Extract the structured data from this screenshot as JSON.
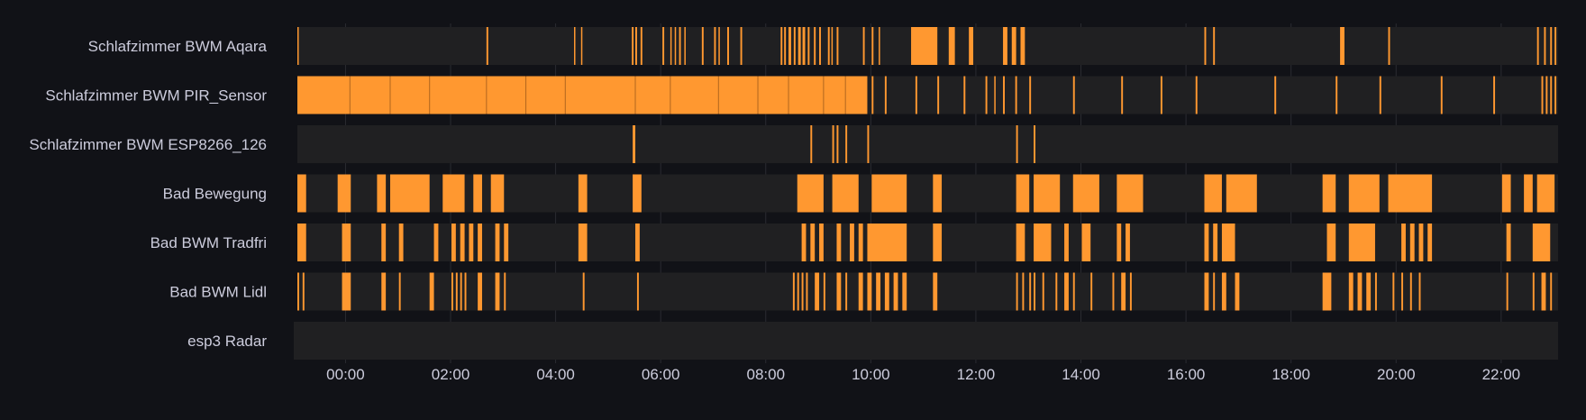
{
  "chart_data": {
    "type": "state-timeline",
    "x_range": [
      "23:05",
      "23:05"
    ],
    "x_tick_labels": [
      "00:00",
      "02:00",
      "04:00",
      "06:00",
      "08:00",
      "10:00",
      "12:00",
      "14:00",
      "16:00",
      "18:00",
      "20:00",
      "22:00"
    ],
    "active_color": "#ff9830",
    "inactive_color": "#202022",
    "grid": true,
    "rows": [
      {
        "label": "Schlafzimmer BWM Aqara",
        "active_intervals": [
          [
            "23:05",
            "23:06"
          ],
          [
            "02:41",
            "02:43"
          ],
          [
            "04:21",
            "04:22"
          ],
          [
            "04:29",
            "04:30"
          ],
          [
            "05:27",
            "05:29"
          ],
          [
            "05:31",
            "05:33"
          ],
          [
            "05:37",
            "05:39"
          ],
          [
            "06:02",
            "06:04"
          ],
          [
            "06:11",
            "06:12"
          ],
          [
            "06:16",
            "06:17"
          ],
          [
            "06:21",
            "06:23"
          ],
          [
            "06:27",
            "06:28"
          ],
          [
            "06:47",
            "06:49"
          ],
          [
            "07:01",
            "07:03"
          ],
          [
            "07:06",
            "07:07"
          ],
          [
            "07:16",
            "07:18"
          ],
          [
            "07:31",
            "07:33"
          ],
          [
            "08:17",
            "08:19"
          ],
          [
            "08:21",
            "08:23"
          ],
          [
            "08:26",
            "08:29"
          ],
          [
            "08:32",
            "08:34"
          ],
          [
            "08:37",
            "08:40"
          ],
          [
            "08:42",
            "08:45"
          ],
          [
            "08:48",
            "08:50"
          ],
          [
            "08:55",
            "08:57"
          ],
          [
            "09:01",
            "09:03"
          ],
          [
            "09:11",
            "09:13"
          ],
          [
            "09:15",
            "09:16"
          ],
          [
            "09:21",
            "09:23"
          ],
          [
            "09:51",
            "09:53"
          ],
          [
            "10:01",
            "10:03"
          ],
          [
            "10:09",
            "10:10"
          ],
          [
            "10:46",
            "11:16"
          ],
          [
            "11:29",
            "11:36"
          ],
          [
            "11:52",
            "11:57"
          ],
          [
            "12:31",
            "12:36"
          ],
          [
            "12:41",
            "12:46"
          ],
          [
            "12:51",
            "12:56"
          ],
          [
            "16:21",
            "16:23"
          ],
          [
            "16:31",
            "16:33"
          ],
          [
            "18:56",
            "19:01"
          ],
          [
            "19:51",
            "19:53"
          ],
          [
            "22:41",
            "22:43"
          ],
          [
            "22:49",
            "22:51"
          ],
          [
            "22:56",
            "22:58"
          ],
          [
            "23:01",
            "23:03"
          ]
        ]
      },
      {
        "label": "Schlafzimmer BWM PIR_Sensor",
        "active_intervals": [
          [
            "23:05",
            "09:56"
          ],
          [
            "10:01",
            "10:03"
          ],
          [
            "10:16",
            "10:18"
          ],
          [
            "10:51",
            "10:53"
          ],
          [
            "11:16",
            "11:18"
          ],
          [
            "11:46",
            "11:48"
          ],
          [
            "12:11",
            "12:13"
          ],
          [
            "12:21",
            "12:22"
          ],
          [
            "12:31",
            "12:33"
          ],
          [
            "12:45",
            "12:47"
          ],
          [
            "13:01",
            "13:03"
          ],
          [
            "13:51",
            "13:53"
          ],
          [
            "14:46",
            "14:48"
          ],
          [
            "15:31",
            "15:33"
          ],
          [
            "16:11",
            "16:13"
          ],
          [
            "17:41",
            "17:43"
          ],
          [
            "18:51",
            "18:53"
          ],
          [
            "19:41",
            "19:43"
          ],
          [
            "20:51",
            "20:53"
          ],
          [
            "21:51",
            "21:53"
          ],
          [
            "22:46",
            "22:48"
          ],
          [
            "22:51",
            "22:53"
          ],
          [
            "22:56",
            "22:58"
          ],
          [
            "23:01",
            "23:03"
          ]
        ]
      },
      {
        "label": "Schlafzimmer BWM ESP8266_126",
        "active_intervals": [
          [
            "05:28",
            "05:31"
          ],
          [
            "08:51",
            "08:53"
          ],
          [
            "09:16",
            "09:18"
          ],
          [
            "09:21",
            "09:23"
          ],
          [
            "09:31",
            "09:33"
          ],
          [
            "09:56",
            "09:58"
          ],
          [
            "12:46",
            "12:48"
          ],
          [
            "13:06",
            "13:08"
          ]
        ]
      },
      {
        "label": "Bad Bewegung",
        "active_intervals": [
          [
            "23:05",
            "23:15"
          ],
          [
            "23:51",
            "00:06"
          ],
          [
            "00:36",
            "00:46"
          ],
          [
            "00:51",
            "01:36"
          ],
          [
            "01:51",
            "02:16"
          ],
          [
            "02:26",
            "02:36"
          ],
          [
            "02:46",
            "03:01"
          ],
          [
            "04:26",
            "04:36"
          ],
          [
            "05:28",
            "05:38"
          ],
          [
            "08:36",
            "09:06"
          ],
          [
            "09:16",
            "09:46"
          ],
          [
            "10:01",
            "10:41"
          ],
          [
            "11:11",
            "11:21"
          ],
          [
            "12:46",
            "13:01"
          ],
          [
            "13:06",
            "13:36"
          ],
          [
            "13:51",
            "14:21"
          ],
          [
            "14:41",
            "15:11"
          ],
          [
            "16:21",
            "16:41"
          ],
          [
            "16:46",
            "17:21"
          ],
          [
            "18:36",
            "18:51"
          ],
          [
            "19:06",
            "19:41"
          ],
          [
            "19:51",
            "20:41"
          ],
          [
            "22:01",
            "22:11"
          ],
          [
            "22:26",
            "22:36"
          ],
          [
            "22:41",
            "23:01"
          ]
        ]
      },
      {
        "label": "Bad BWM Tradfri",
        "active_intervals": [
          [
            "23:05",
            "23:15"
          ],
          [
            "23:56",
            "00:06"
          ],
          [
            "00:41",
            "00:46"
          ],
          [
            "01:01",
            "01:06"
          ],
          [
            "01:41",
            "01:46"
          ],
          [
            "02:01",
            "02:06"
          ],
          [
            "02:11",
            "02:16"
          ],
          [
            "02:21",
            "02:26"
          ],
          [
            "02:31",
            "02:36"
          ],
          [
            "02:51",
            "02:56"
          ],
          [
            "03:01",
            "03:06"
          ],
          [
            "04:26",
            "04:36"
          ],
          [
            "05:31",
            "05:36"
          ],
          [
            "08:41",
            "08:46"
          ],
          [
            "08:51",
            "08:56"
          ],
          [
            "09:01",
            "09:06"
          ],
          [
            "09:21",
            "09:26"
          ],
          [
            "09:36",
            "09:41"
          ],
          [
            "09:46",
            "09:51"
          ],
          [
            "09:56",
            "10:41"
          ],
          [
            "11:11",
            "11:21"
          ],
          [
            "12:46",
            "12:56"
          ],
          [
            "13:06",
            "13:26"
          ],
          [
            "13:41",
            "13:46"
          ],
          [
            "14:01",
            "14:11"
          ],
          [
            "14:41",
            "14:46"
          ],
          [
            "14:51",
            "14:56"
          ],
          [
            "16:21",
            "16:26"
          ],
          [
            "16:31",
            "16:36"
          ],
          [
            "16:41",
            "16:56"
          ],
          [
            "18:41",
            "18:51"
          ],
          [
            "19:06",
            "19:36"
          ],
          [
            "20:06",
            "20:11"
          ],
          [
            "20:16",
            "20:21"
          ],
          [
            "20:26",
            "20:31"
          ],
          [
            "20:36",
            "20:41"
          ],
          [
            "22:06",
            "22:11"
          ],
          [
            "22:36",
            "22:56"
          ]
        ]
      },
      {
        "label": "Bad BWM Lidl",
        "active_intervals": [
          [
            "23:05",
            "23:07"
          ],
          [
            "23:11",
            "23:13"
          ],
          [
            "23:56",
            "00:06"
          ],
          [
            "00:41",
            "00:46"
          ],
          [
            "01:01",
            "01:03"
          ],
          [
            "01:36",
            "01:41"
          ],
          [
            "02:01",
            "02:03"
          ],
          [
            "02:06",
            "02:08"
          ],
          [
            "02:11",
            "02:13"
          ],
          [
            "02:16",
            "02:18"
          ],
          [
            "02:31",
            "02:36"
          ],
          [
            "02:51",
            "02:56"
          ],
          [
            "03:01",
            "03:03"
          ],
          [
            "04:31",
            "04:33"
          ],
          [
            "05:33",
            "05:35"
          ],
          [
            "08:31",
            "08:33"
          ],
          [
            "08:36",
            "08:38"
          ],
          [
            "08:41",
            "08:43"
          ],
          [
            "08:46",
            "08:48"
          ],
          [
            "08:56",
            "09:01"
          ],
          [
            "09:06",
            "09:08"
          ],
          [
            "09:21",
            "09:26"
          ],
          [
            "09:31",
            "09:33"
          ],
          [
            "09:46",
            "09:51"
          ],
          [
            "09:56",
            "10:01"
          ],
          [
            "10:06",
            "10:11"
          ],
          [
            "10:16",
            "10:21"
          ],
          [
            "10:26",
            "10:31"
          ],
          [
            "10:36",
            "10:41"
          ],
          [
            "11:11",
            "11:16"
          ],
          [
            "12:46",
            "12:48"
          ],
          [
            "12:53",
            "12:55"
          ],
          [
            "13:01",
            "13:03"
          ],
          [
            "13:06",
            "13:08"
          ],
          [
            "13:16",
            "13:18"
          ],
          [
            "13:31",
            "13:33"
          ],
          [
            "13:41",
            "13:46"
          ],
          [
            "13:51",
            "13:53"
          ],
          [
            "14:11",
            "14:13"
          ],
          [
            "14:36",
            "14:38"
          ],
          [
            "14:46",
            "14:51"
          ],
          [
            "14:56",
            "14:58"
          ],
          [
            "16:21",
            "16:26"
          ],
          [
            "16:31",
            "16:33"
          ],
          [
            "16:41",
            "16:46"
          ],
          [
            "16:56",
            "17:01"
          ],
          [
            "18:36",
            "18:46"
          ],
          [
            "19:06",
            "19:11"
          ],
          [
            "19:16",
            "19:21"
          ],
          [
            "19:26",
            "19:31"
          ],
          [
            "19:36",
            "19:38"
          ],
          [
            "19:56",
            "19:58"
          ],
          [
            "20:06",
            "20:08"
          ],
          [
            "20:16",
            "20:18"
          ],
          [
            "20:26",
            "20:28"
          ],
          [
            "22:06",
            "22:08"
          ],
          [
            "22:36",
            "22:38"
          ],
          [
            "22:46",
            "22:51"
          ],
          [
            "22:56",
            "22:58"
          ]
        ]
      },
      {
        "label": "esp3 Radar",
        "active_intervals": []
      }
    ]
  }
}
